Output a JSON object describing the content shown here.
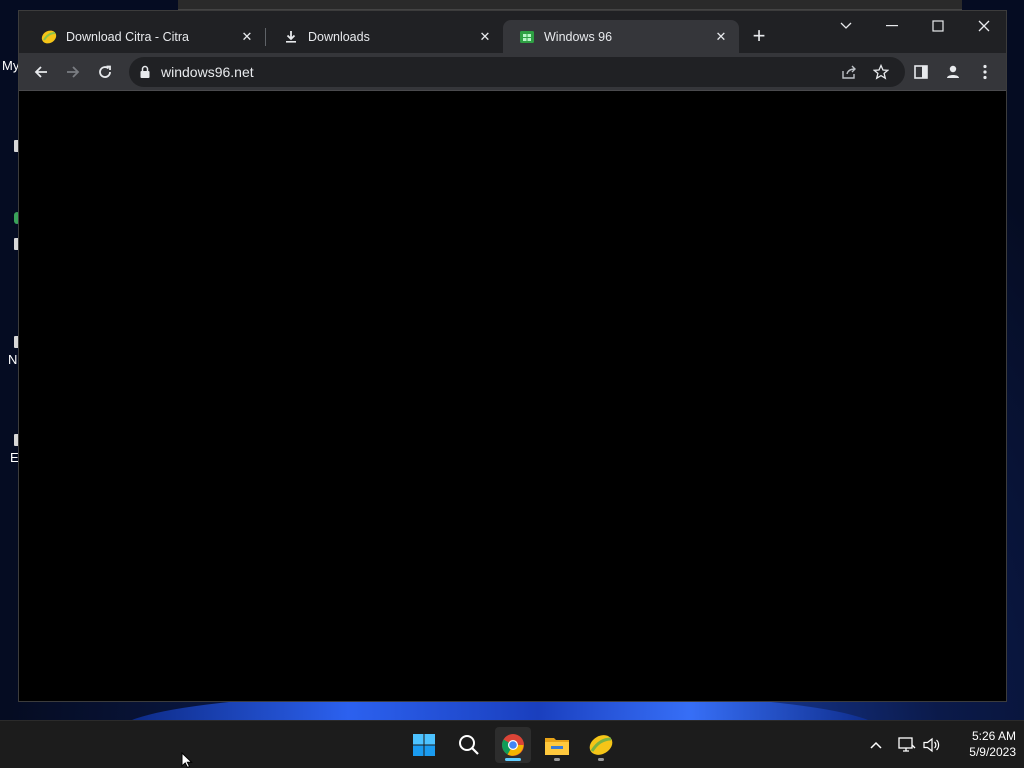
{
  "desktop": {
    "labels": [
      "My",
      "N",
      "E"
    ]
  },
  "browser": {
    "tabs": [
      {
        "title": "Download Citra - Citra",
        "icon": "citra-icon",
        "close": "✕"
      },
      {
        "title": "Downloads",
        "icon": "download-icon",
        "close": "✕"
      },
      {
        "title": "Windows 96",
        "icon": "windows96-icon",
        "close": "✕",
        "active": true
      }
    ],
    "new_tab_label": "+",
    "address": "windows96.net"
  },
  "taskbar": {
    "apps": [
      {
        "name": "start",
        "icon": "windows-start-icon"
      },
      {
        "name": "search",
        "icon": "search-icon"
      },
      {
        "name": "chrome",
        "icon": "chrome-icon",
        "active": true
      },
      {
        "name": "file-explorer",
        "icon": "folder-icon",
        "running": true
      },
      {
        "name": "citra",
        "icon": "citra-icon",
        "running": true
      }
    ],
    "clock": {
      "time": "5:26 AM",
      "date": "5/9/2023"
    }
  },
  "colors": {
    "accent": "#60cdff",
    "browser_frame": "#202124",
    "toolbar": "#35363a",
    "taskbar": "#1c1c1c"
  }
}
